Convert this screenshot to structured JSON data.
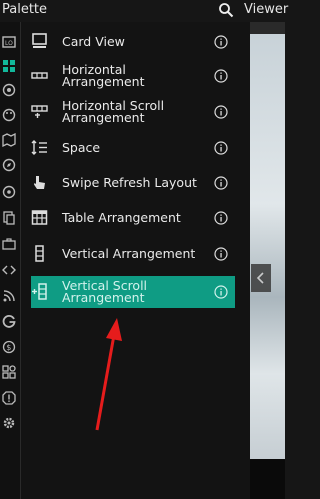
{
  "header": {
    "palette_title": "Palette",
    "viewer_title": "Viewer"
  },
  "rail": {
    "icons": [
      "layout-icon",
      "grid-icon",
      "theme-icon",
      "palette-icon",
      "map-icon",
      "compass-icon",
      "sensor-icon",
      "storage-icon",
      "briefcase-icon",
      "code-icon",
      "rss-icon",
      "google-icon",
      "currency-icon",
      "extensions-icon",
      "alert-icon",
      "settings-icon"
    ],
    "active_index": 1
  },
  "palette_items": [
    {
      "label": "Card View",
      "icon": "card-view-icon"
    },
    {
      "label": "Horizontal Arrangement",
      "icon": "horizontal-arrangement-icon"
    },
    {
      "label": "Horizontal Scroll Arrangement",
      "icon": "horizontal-scroll-icon"
    },
    {
      "label": "Space",
      "icon": "space-icon"
    },
    {
      "label": "Swipe Refresh Layout",
      "icon": "swipe-refresh-icon"
    },
    {
      "label": "Table Arrangement",
      "icon": "table-icon"
    },
    {
      "label": "Vertical Arrangement",
      "icon": "vertical-arrangement-icon"
    },
    {
      "label": "Vertical Scroll Arrangement",
      "icon": "vertical-scroll-icon"
    }
  ],
  "selected_index": 7,
  "colors": {
    "selected": "#0f9c84",
    "annotation_arrow": "#e61c1c"
  }
}
